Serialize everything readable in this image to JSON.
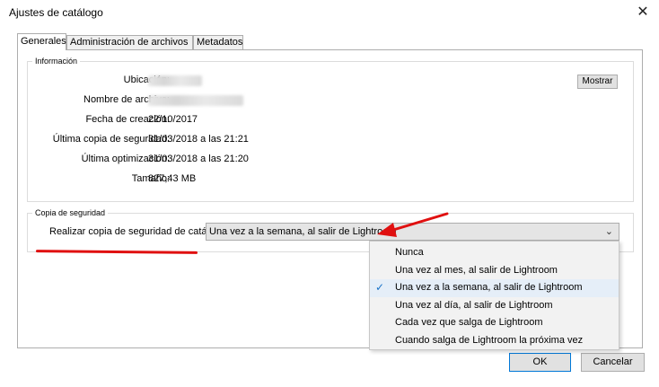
{
  "window": {
    "title": "Ajustes de catálogo",
    "close_glyph": "✕"
  },
  "tabs": [
    {
      "label": "Generales"
    },
    {
      "label": "Administración de archivos"
    },
    {
      "label": "Metadatos"
    }
  ],
  "info": {
    "group_label": "Información",
    "show_button": "Mostrar",
    "rows": [
      {
        "label": "Ubicación:",
        "value": ""
      },
      {
        "label": "Nombre de archivo:",
        "value": ""
      },
      {
        "label": "Fecha de creación:",
        "value": "22/10/2017"
      },
      {
        "label": "Última copia de seguridad:",
        "value": "31/03/2018 a las 21:21"
      },
      {
        "label": "Última optimización:",
        "value": "31/03/2018 a las 21:20"
      },
      {
        "label": "Tamaño:",
        "value": "827,43 MB"
      }
    ]
  },
  "backup": {
    "group_label": "Copia de seguridad",
    "label": "Realizar copia de seguridad de catálogo:",
    "selected": "Una vez a la semana, al salir de Lightroom",
    "options": [
      "Nunca",
      "Una vez al mes, al salir de Lightroom",
      "Una vez a la semana, al salir de Lightroom",
      "Una vez al día, al salir de Lightroom",
      "Cada vez que salga de Lightroom",
      "Cuando salga de Lightroom la próxima vez"
    ],
    "selected_index": 2
  },
  "buttons": {
    "ok": "OK",
    "cancel": "Cancelar"
  },
  "colors": {
    "annotation": "#e01010",
    "check": "#1a73c8",
    "focus_border": "#0078d7"
  },
  "icons": {
    "close": "close-icon",
    "dropdown": "chevron-down-icon",
    "check": "checkmark-icon"
  }
}
